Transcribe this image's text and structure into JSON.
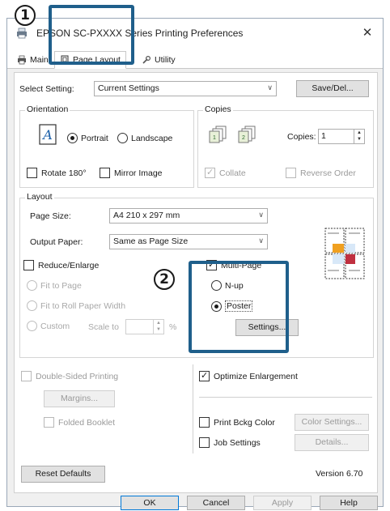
{
  "callouts": {
    "one": "1",
    "two": "2"
  },
  "window": {
    "title": "EPSON SC-PXXXX Series Printing Preferences"
  },
  "tabs": [
    {
      "label": "Main"
    },
    {
      "label": "Page Layout"
    },
    {
      "label": "Utility"
    }
  ],
  "select_setting": {
    "label": "Select Setting:",
    "value": "Current Settings",
    "save_button": "Save/Del..."
  },
  "orientation": {
    "title": "Orientation",
    "portrait": "Portrait",
    "landscape": "Landscape",
    "rotate180": "Rotate 180°",
    "mirror": "Mirror Image"
  },
  "copies": {
    "title": "Copies",
    "label": "Copies:",
    "value": "1",
    "collate": "Collate",
    "reverse": "Reverse Order"
  },
  "layout": {
    "title": "Layout",
    "page_size_label": "Page Size:",
    "page_size_value": "A4 210 x 297 mm",
    "output_paper_label": "Output Paper:",
    "output_paper_value": "Same as Page Size",
    "reduce_enlarge": "Reduce/Enlarge",
    "fit_to_page": "Fit to Page",
    "fit_to_roll": "Fit to Roll Paper Width",
    "custom": "Custom",
    "scale_to": "Scale to",
    "percent": "%",
    "multi_page": "Multi-Page",
    "n_up": "N-up",
    "poster": "Poster",
    "settings_button": "Settings..."
  },
  "double_sided": {
    "label": "Double-Sided Printing",
    "margins_button": "Margins...",
    "folded_booklet": "Folded Booklet"
  },
  "optimize": {
    "label": "Optimize Enlargement"
  },
  "print_bckg": {
    "label": "Print Bckg Color",
    "button": "Color Settings..."
  },
  "job_settings": {
    "label": "Job Settings",
    "button": "Details..."
  },
  "footer": {
    "reset": "Reset Defaults",
    "version": "Version 6.70"
  },
  "dialog_buttons": {
    "ok": "OK",
    "cancel": "Cancel",
    "apply": "Apply",
    "help": "Help"
  },
  "colors": {
    "highlight": "#1f5f8b",
    "focus": "#0078d7"
  }
}
